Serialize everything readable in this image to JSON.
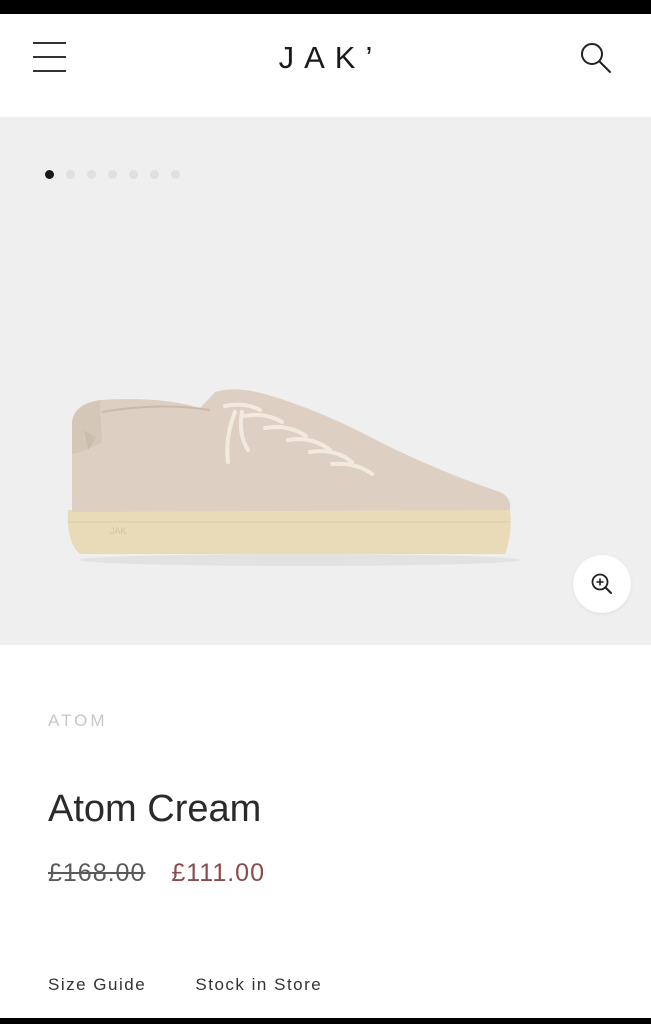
{
  "header": {
    "logo": "JAK’",
    "icons": {
      "menu": "hamburger-menu-icon",
      "search": "search-icon"
    }
  },
  "gallery": {
    "image_count": 7,
    "active_index": 0,
    "zoom_icon": "zoom-in-icon"
  },
  "product": {
    "collection": "ATOM",
    "name": "Atom Cream",
    "original_price": "£168.00",
    "sale_price": "£111.00"
  },
  "links": {
    "size_guide": "Size Guide",
    "stock_in_store": "Stock in Store"
  },
  "colors": {
    "accent_price": "#8b4b4b",
    "gallery_bg": "#efefef"
  }
}
